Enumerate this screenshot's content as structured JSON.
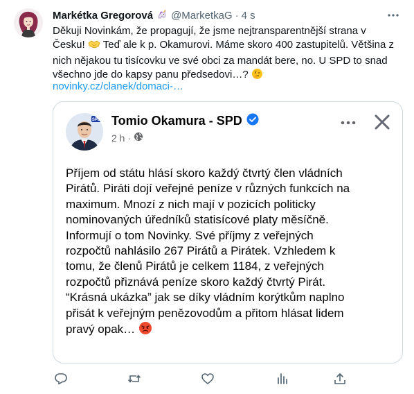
{
  "tweet": {
    "author_name": "Markétka Gregorová",
    "handle": "@MarketkaG",
    "dot": "·",
    "time": "4 s",
    "body_lines": [
      "Děkuji Novinkám, že propagují, že jsme nejtransparentnější strana v",
      "Česku! ",
      "nich nějakou tu tisícovku ve své obci za mandát bere, no. U SPD to snad",
      "všechno jde do kapsy panu předsedovi…? "
    ],
    "body_line2_tail": " Teď ale k p. Okamurovi. Máme skoro 400 zastupitelů. Většina z",
    "link_text": "novinky.cz/clanek/domaci-…"
  },
  "card": {
    "author_name": "Tomio Okamura - SPD",
    "time": "2 h",
    "sep": "·",
    "avatar_badge": "SPD",
    "text_lines": [
      "Příjem od státu hlásí skoro každý čtvrtý člen vládních",
      "Pirátů. Piráti dojí veřejné peníze v různých funkcích na",
      "maximum. Mnozí z nich mají v pozicích politicky",
      "nominovaných úředníků statisícové platy měsíčně.",
      "Informují o tom Novinky. Své příjmy z veřejných",
      "rozpočtů nahlásilo 267 Pirátů a Pirátek. Vzhledem k",
      "tomu, že členů Pirátů je celkem 1184, z veřejných",
      "rozpočtů přiznává peníze skoro každý čtvrtý Pirát.",
      "“Krásná ukázka” jak se díky vládním korýtkům naplno",
      "přisát k veřejným penězovodům a přitom hlásat lidem",
      "pravý opak… "
    ]
  },
  "icons": {
    "unicorn": "unicorn-emoji",
    "handshake": "handshake-emoji",
    "thinking": "thinking-face-emoji",
    "angry": "angry-face-emoji",
    "verified": "verified-badge-icon",
    "globe": "globe-icon"
  },
  "colors": {
    "link": "#1d9bf0",
    "secondary_text": "#536471",
    "verified": "#1877f2",
    "border": "#cfd9de"
  }
}
